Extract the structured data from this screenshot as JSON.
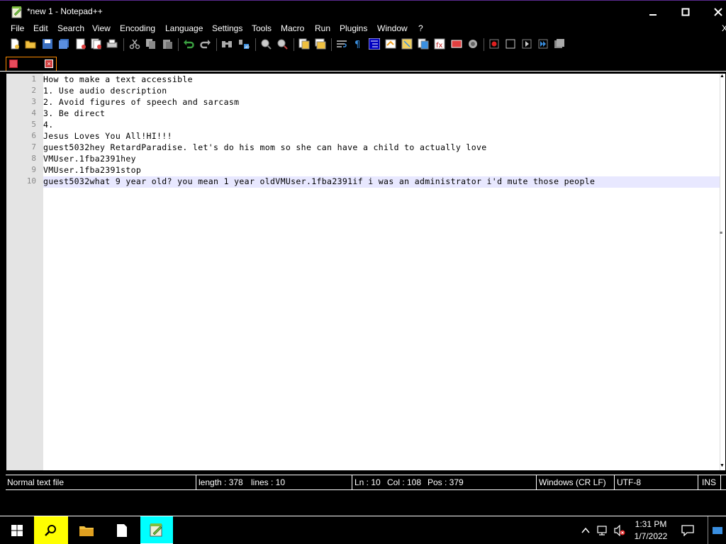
{
  "window": {
    "title": "*new 1 - Notepad++",
    "minimize": "−",
    "maximize": "□",
    "close": "✕"
  },
  "menu": [
    "File",
    "Edit",
    "Search",
    "View",
    "Encoding",
    "Language",
    "Settings",
    "Tools",
    "Macro",
    "Run",
    "Plugins",
    "Window",
    "?"
  ],
  "menu_close": "X",
  "toolbar": {
    "icons": [
      "new-icon",
      "open-icon",
      "save-icon",
      "save-all-icon",
      "close-icon",
      "close-all-icon",
      "print-icon",
      "cut-icon",
      "copy-icon",
      "paste-icon",
      "undo-icon",
      "redo-icon",
      "find-icon",
      "replace-icon",
      "zoom-in-icon",
      "zoom-out-icon",
      "sync-vertical-icon",
      "sync-horizontal-icon",
      "word-wrap-icon",
      "show-all-chars-icon",
      "indent-guide-icon",
      "udl-icon",
      "doc-map-icon",
      "function-list-icon",
      "folder-workspace-icon",
      "monitoring-icon",
      "record-macro-icon",
      "stop-record-icon",
      "play-macro-icon",
      "run-macro-multiple-icon",
      "save-macro-icon"
    ]
  },
  "tab": {
    "save_icon": "tab-save-icon",
    "close_label": "×"
  },
  "editor": {
    "lines": [
      {
        "n": "1",
        "text": "How to make a text accessible"
      },
      {
        "n": "2",
        "text": "1. Use audio description"
      },
      {
        "n": "3",
        "text": "2. Avoid figures of speech and sarcasm"
      },
      {
        "n": "4",
        "text": "3. Be direct"
      },
      {
        "n": "5",
        "text": "4."
      },
      {
        "n": "6",
        "text": "Jesus Loves You All!HI!!!"
      },
      {
        "n": "7",
        "text": "guest5032hey RetardParadise. let's do his mom so she can have a child to actually love"
      },
      {
        "n": "8",
        "text": "VMUser.1fba2391hey"
      },
      {
        "n": "9",
        "text": "VMUser.1fba2391stop"
      },
      {
        "n": "10",
        "text": "guest5032what 9 year old? you mean 1 year oldVMUser.1fba2391if i was an administrator i'd mute those people"
      }
    ],
    "current_line": "10"
  },
  "status": {
    "file_type": "Normal text file",
    "length": "length : 378",
    "lines": "lines : 10",
    "ln": "Ln : 10",
    "col": "Col : 108",
    "pos": "Pos : 379",
    "eol": "Windows (CR LF)",
    "encoding": "UTF-8",
    "mode": "INS"
  },
  "taskbar": {
    "time": "1:31 PM",
    "date": "1/7/2022"
  },
  "colors": {
    "accent_purple": "#5a2b8f",
    "search_yellow": "#ffff00",
    "tab_orange": "#ff8c00",
    "current_line": "#e8e8ff",
    "active_task": "#00ffff"
  }
}
